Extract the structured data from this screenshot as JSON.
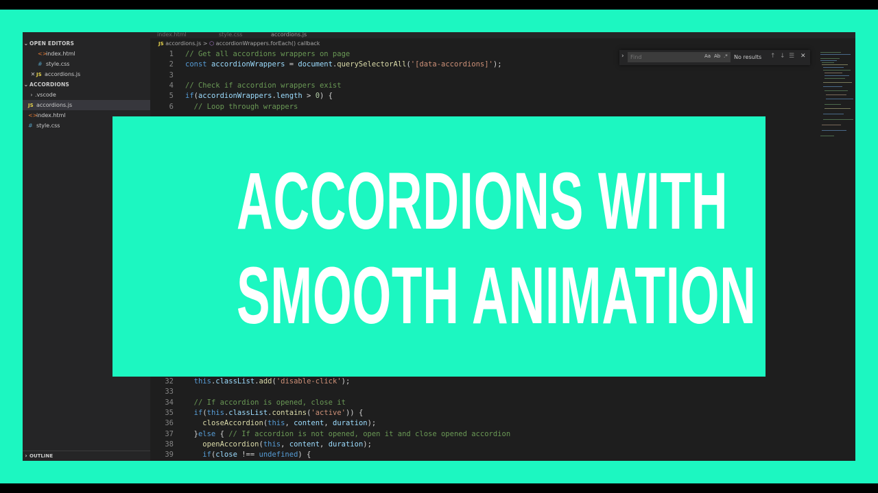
{
  "sidebar": {
    "sections": [
      {
        "label": "OPEN EDITORS"
      },
      {
        "label": "ACCORDIONS"
      },
      {
        "label": "OUTLINE"
      }
    ],
    "open_editors": [
      {
        "label": "index.html",
        "icon": "html-file-icon"
      },
      {
        "label": "style.css",
        "icon": "css-file-icon"
      },
      {
        "label": "accordions.js",
        "icon": "js-file-icon"
      }
    ],
    "explorer": [
      {
        "label": ".vscode",
        "icon": "folder-chevron-icon"
      },
      {
        "label": "accordions.js",
        "icon": "js-file-icon"
      },
      {
        "label": "index.html",
        "icon": "html-file-icon"
      },
      {
        "label": "style.css",
        "icon": "css-file-icon"
      }
    ]
  },
  "tabs": [
    {
      "label": "index.html"
    },
    {
      "label": "style.css"
    },
    {
      "label": "accordions.js"
    }
  ],
  "breadcrumb": {
    "file_badge": "JS",
    "file": "accordions.js",
    "separator": ">",
    "symbol": "accordionWrappers.forEach() callback"
  },
  "find": {
    "placeholder": "Find",
    "match_case": "Aa",
    "whole_word": "Ab",
    "regex": ".*",
    "results": "No results"
  },
  "code": {
    "top_lines": [
      {
        "n": "1",
        "segs": [
          [
            "c",
            "// Get all accordions wrappers on page"
          ]
        ]
      },
      {
        "n": "2",
        "segs": [
          [
            "k",
            "const "
          ],
          [
            "v",
            "accordionWrappers"
          ],
          [
            "p",
            " = "
          ],
          [
            "v",
            "document"
          ],
          [
            "p",
            "."
          ],
          [
            "f",
            "querySelectorAll"
          ],
          [
            "p",
            "("
          ],
          [
            "s",
            "'[data-accordions]'"
          ],
          [
            "p",
            ");"
          ]
        ]
      },
      {
        "n": "3",
        "segs": []
      },
      {
        "n": "4",
        "segs": [
          [
            "c",
            "// Check if accordion wrappers exist"
          ]
        ]
      },
      {
        "n": "5",
        "segs": [
          [
            "k",
            "if"
          ],
          [
            "p",
            "("
          ],
          [
            "v",
            "accordionWrappers"
          ],
          [
            "p",
            "."
          ],
          [
            "v",
            "length"
          ],
          [
            "p",
            " > "
          ],
          [
            "n",
            "0"
          ],
          [
            "p",
            ") {"
          ]
        ]
      },
      {
        "n": "6",
        "segs": [
          [
            "p",
            "  "
          ],
          [
            "c",
            "// Loop through wrappers"
          ]
        ]
      }
    ],
    "bottom_lines": [
      {
        "n": "32",
        "segs": [
          [
            "p",
            "  "
          ],
          [
            "t",
            "this"
          ],
          [
            "p",
            "."
          ],
          [
            "v",
            "classList"
          ],
          [
            "p",
            "."
          ],
          [
            "f",
            "add"
          ],
          [
            "p",
            "("
          ],
          [
            "s",
            "'disable-click'"
          ],
          [
            "p",
            ");"
          ]
        ]
      },
      {
        "n": "33",
        "segs": []
      },
      {
        "n": "34",
        "segs": [
          [
            "p",
            "  "
          ],
          [
            "c",
            "// If accordion is opened, close it"
          ]
        ]
      },
      {
        "n": "35",
        "segs": [
          [
            "p",
            "  "
          ],
          [
            "k",
            "if"
          ],
          [
            "p",
            "("
          ],
          [
            "t",
            "this"
          ],
          [
            "p",
            "."
          ],
          [
            "v",
            "classList"
          ],
          [
            "p",
            "."
          ],
          [
            "f",
            "contains"
          ],
          [
            "p",
            "("
          ],
          [
            "s",
            "'active'"
          ],
          [
            "p",
            ")) {"
          ]
        ]
      },
      {
        "n": "36",
        "segs": [
          [
            "p",
            "    "
          ],
          [
            "f",
            "closeAccordion"
          ],
          [
            "p",
            "("
          ],
          [
            "t",
            "this"
          ],
          [
            "p",
            ", "
          ],
          [
            "v",
            "content"
          ],
          [
            "p",
            ", "
          ],
          [
            "v",
            "duration"
          ],
          [
            "p",
            ");"
          ]
        ]
      },
      {
        "n": "37",
        "segs": [
          [
            "p",
            "  }"
          ],
          [
            "k",
            "else"
          ],
          [
            "p",
            " { "
          ],
          [
            "c",
            "// If accordion is not opened, open it and close opened accordion"
          ]
        ]
      },
      {
        "n": "38",
        "segs": [
          [
            "p",
            "    "
          ],
          [
            "f",
            "openAccordion"
          ],
          [
            "p",
            "("
          ],
          [
            "t",
            "this"
          ],
          [
            "p",
            ", "
          ],
          [
            "v",
            "content"
          ],
          [
            "p",
            ", "
          ],
          [
            "v",
            "duration"
          ],
          [
            "p",
            ");"
          ]
        ]
      },
      {
        "n": "39",
        "segs": [
          [
            "p",
            "    "
          ],
          [
            "k",
            "if"
          ],
          [
            "p",
            "("
          ],
          [
            "v",
            "close"
          ],
          [
            "p",
            " !== "
          ],
          [
            "t",
            "undefined"
          ],
          [
            "p",
            ") {"
          ]
        ]
      }
    ]
  },
  "overlay": {
    "line1": "ACCORDIONS WITH",
    "line2": "SMOOTH ANIMATION"
  },
  "colors": {
    "accent": "#1cf7c1",
    "editor_bg": "#1e1e1e",
    "sidebar_bg": "#252526"
  }
}
